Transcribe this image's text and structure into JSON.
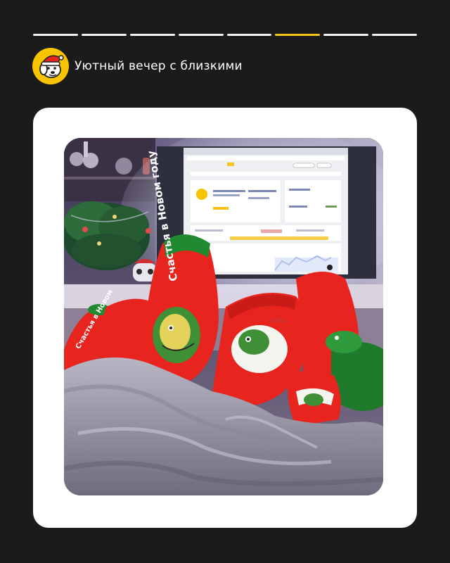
{
  "story": {
    "segments_total": 8,
    "active_index": 5
  },
  "header": {
    "title": "Уютный вечер с близкими",
    "logo_icon": "dog-santa-hat-logo"
  },
  "photo": {
    "sock_text_left": "Счастья в Новом году",
    "sock_text_small": "Счастья в Новом",
    "colors": {
      "sock_red": "#e8241e",
      "sock_green": "#1f8a2f",
      "blanket": "#9a97a6",
      "screen": "#eef0f4",
      "accent": "#f5c21a"
    }
  }
}
